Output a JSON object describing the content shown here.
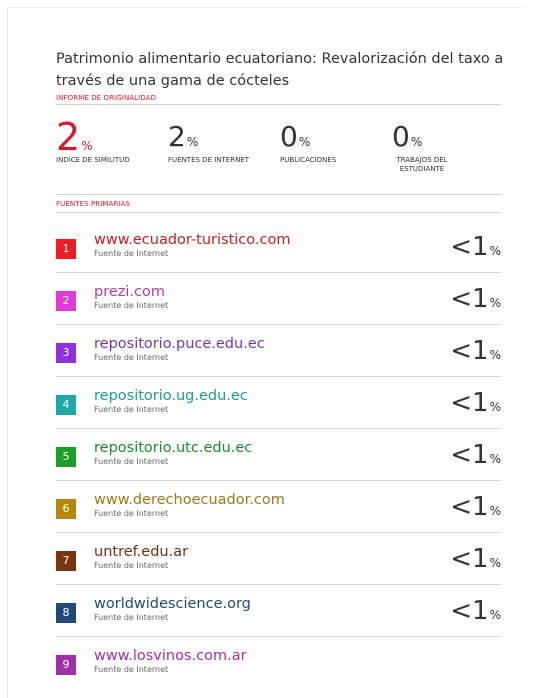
{
  "title": "Patrimonio alimentario ecuatoriano: Revalorización del taxo a través de una gama de cócteles",
  "section_originality": "INFORME DE ORIGINALIDAD",
  "stats": [
    {
      "value": "2",
      "unit": "%",
      "caption": "INDICE DE SIMILITUD",
      "color": "#d9182d"
    },
    {
      "value": "2",
      "unit": "%",
      "caption": "FUENTES DE INTERNET"
    },
    {
      "value": "0",
      "unit": "%",
      "caption": "PUBLICACIONES"
    },
    {
      "value": "0",
      "unit": "%",
      "caption": "TRABAJOS DEL ESTUDIANTE"
    }
  ],
  "section_sources": "FUENTES PRIMARIAS",
  "sources": [
    {
      "n": "1",
      "url": "www.ecuador-turistico.com",
      "kind": "Fuente de Internet",
      "score": "<1",
      "unit": "%",
      "color": "#ee1c25",
      "text_color": "#c81e1e"
    },
    {
      "n": "2",
      "url": "prezi.com",
      "kind": "Fuente de Internet",
      "score": "<1",
      "unit": "%",
      "color": "#e03bd6",
      "text_color": "#b03ab0"
    },
    {
      "n": "3",
      "url": "repositorio.puce.edu.ec",
      "kind": "Fuente de Internet",
      "score": "<1",
      "unit": "%",
      "color": "#8e2fe0",
      "text_color": "#7a32b8"
    },
    {
      "n": "4",
      "url": "repositorio.ug.edu.ec",
      "kind": "Fuente de Internet",
      "score": "<1",
      "unit": "%",
      "color": "#1ea9a9",
      "text_color": "#1a9a9a"
    },
    {
      "n": "5",
      "url": "repositorio.utc.edu.ec",
      "kind": "Fuente de Internet",
      "score": "<1",
      "unit": "%",
      "color": "#1c9e2a",
      "text_color": "#1d8a2a"
    },
    {
      "n": "6",
      "url": "www.derechoecuador.com",
      "kind": "Fuente de Internet",
      "score": "<1",
      "unit": "%",
      "color": "#b8860b",
      "text_color": "#a07818"
    },
    {
      "n": "7",
      "url": "untref.edu.ar",
      "kind": "Fuente de Internet",
      "score": "<1",
      "unit": "%",
      "color": "#7a3410",
      "text_color": "#6e2f12"
    },
    {
      "n": "8",
      "url": "worldwidescience.org",
      "kind": "Fuente de Internet",
      "score": "<1",
      "unit": "%",
      "color": "#1f4a7a",
      "text_color": "#1f4a7a"
    },
    {
      "n": "9",
      "url": "www.losvinos.com.ar",
      "kind": "Fuente de Internet",
      "score": "",
      "unit": "",
      "color": "#a02fa8",
      "text_color": "#a02fa8"
    }
  ]
}
